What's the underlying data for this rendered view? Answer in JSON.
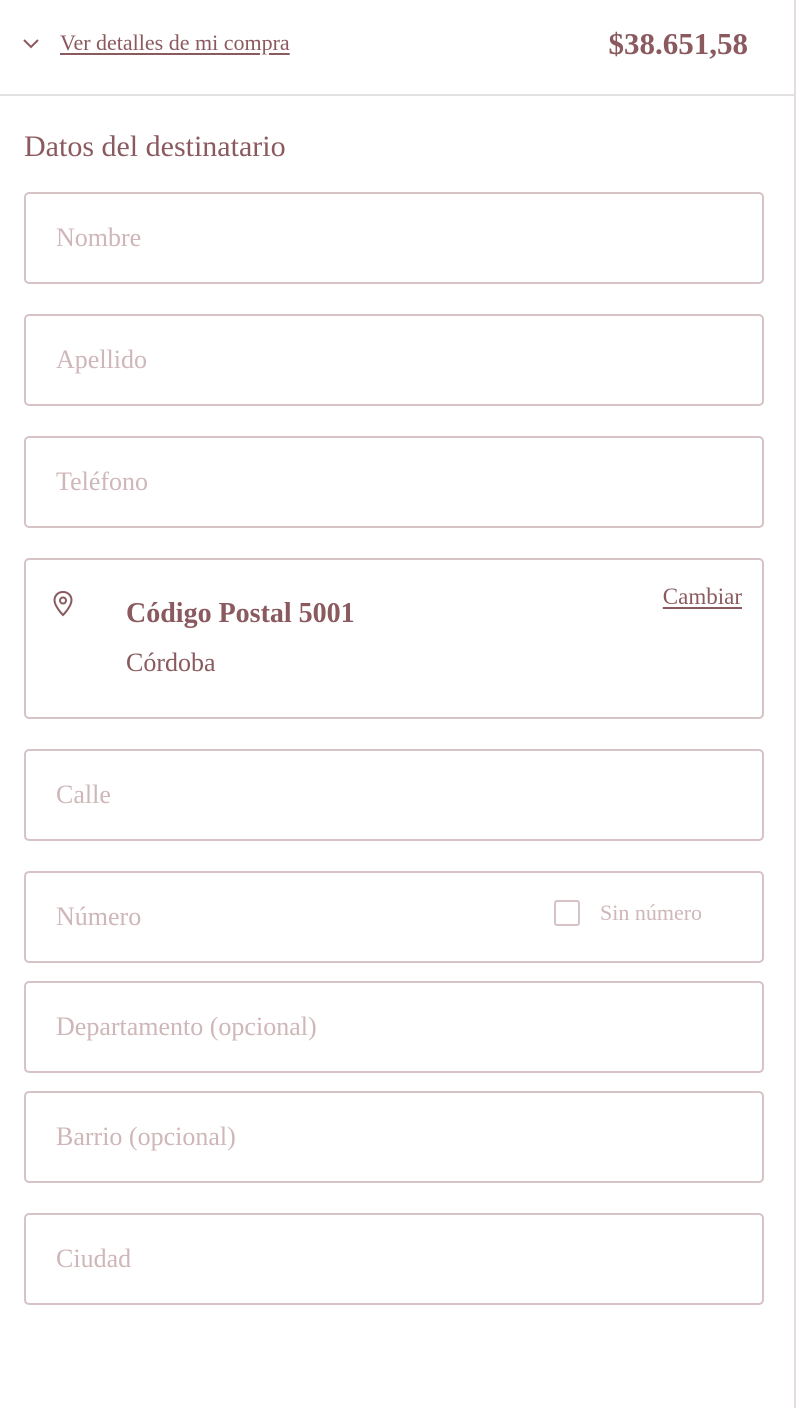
{
  "summary": {
    "toggle_icon": "chevron-down-icon",
    "link_label": "Ver detalles de mi compra",
    "total": "$38.651,58"
  },
  "recipient": {
    "title": "Datos del destinatario",
    "nombre_placeholder": "Nombre",
    "apellido_placeholder": "Apellido",
    "telefono_placeholder": "Teléfono"
  },
  "postal": {
    "icon": "location-pin-icon",
    "code_label": "Código Postal 5001",
    "city": "Córdoba",
    "change_label": "Cambiar"
  },
  "address": {
    "calle_placeholder": "Calle",
    "numero_placeholder": "Número",
    "sin_numero_label": "Sin número",
    "sin_numero_checked": false,
    "departamento_placeholder": "Departamento (opcional)",
    "barrio_placeholder": "Barrio (opcional)",
    "ciudad_placeholder": "Ciudad"
  },
  "colors": {
    "text": "#8a5a5f",
    "placeholder": "#cfb7b9",
    "border": "#d6c3c5"
  }
}
